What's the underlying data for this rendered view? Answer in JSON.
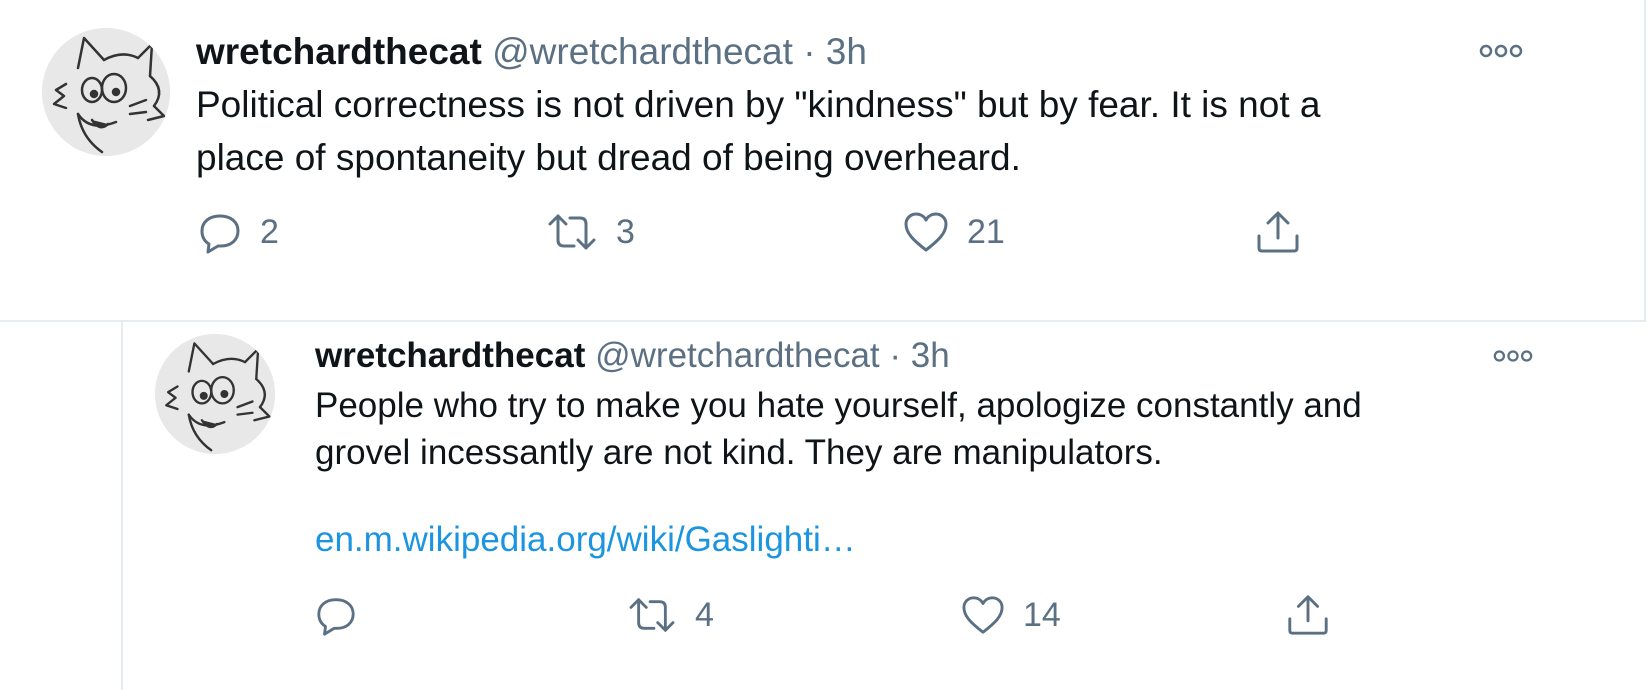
{
  "tweets": [
    {
      "display_name": "wretchardthecat",
      "handle": "@wretchardthecat",
      "separator": "·",
      "time": "3h",
      "text_line1": "Political correctness is not driven by \"kindness\" but by fear. It is not a",
      "text_line2": "place of spontaneity but dread of being overheard.",
      "link": "",
      "actions": {
        "reply_count": "2",
        "retweet_count": "3",
        "like_count": "21",
        "share_count": ""
      },
      "icons": [
        "reply-icon",
        "retweet-icon",
        "like-icon",
        "share-icon",
        "more-icon"
      ]
    },
    {
      "display_name": "wretchardthecat",
      "handle": "@wretchardthecat",
      "separator": "·",
      "time": "3h",
      "text_line1": "People who try to make you hate yourself,  apologize constantly and",
      "text_line2": "grovel incessantly are not kind. They are manipulators.",
      "link": "en.m.wikipedia.org/wiki/Gaslighti…",
      "actions": {
        "reply_count": "",
        "retweet_count": "4",
        "like_count": "14",
        "share_count": ""
      },
      "icons": [
        "reply-icon",
        "retweet-icon",
        "like-icon",
        "share-icon",
        "more-icon"
      ]
    }
  ],
  "colors": {
    "text_primary": "#0f1419",
    "text_secondary": "#5b7083",
    "link": "#1b95e0",
    "border": "#e6ecf0"
  }
}
